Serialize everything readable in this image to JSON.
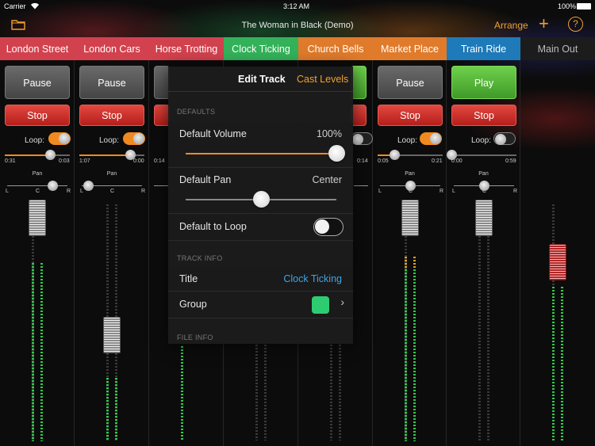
{
  "status": {
    "carrier": "Carrier",
    "time": "3:12 AM",
    "battery": "100%"
  },
  "topbar": {
    "title": "The Woman in Black (Demo)",
    "arrange": "Arrange",
    "add_glyph": "+",
    "help_glyph": "?",
    "folder_icon": "folder-icon"
  },
  "colors": {
    "accent": "#f0a030",
    "link": "#3fa4e8",
    "group": "#2ecc71"
  },
  "tabs": [
    {
      "label": "London Street",
      "color": "#d2424e"
    },
    {
      "label": "London Cars",
      "color": "#d2424e"
    },
    {
      "label": "Horse Trotting",
      "color": "#d2424e"
    },
    {
      "label": "Clock Ticking",
      "color": "#34b25a"
    },
    {
      "label": "Church Bells",
      "color": "#e07b2c"
    },
    {
      "label": "Market Place",
      "color": "#e07b2c"
    },
    {
      "label": "Train Ride",
      "color": "#1e7ab8"
    },
    {
      "label": "Main Out",
      "color": "#1c1c1c"
    }
  ],
  "strips": [
    {
      "name": "London Street",
      "play_label": "Pause",
      "stop_label": "Stop",
      "loop_label": "Loop:",
      "loop_on": true,
      "progress": 0.7,
      "elapsed": "0:31",
      "remaining": "0:03",
      "pan_label": "Pan",
      "pan_l": "L",
      "pan_c": "C",
      "pan_r": "R",
      "pan": 0.75,
      "volume": 0.95
    },
    {
      "name": "London Cars",
      "play_label": "Pause",
      "stop_label": "Stop",
      "loop_label": "Loop:",
      "loop_on": true,
      "progress": 0.78,
      "elapsed": "1:07",
      "remaining": "0:00",
      "pan_label": "Pan",
      "pan_l": "L",
      "pan_c": "C",
      "pan_r": "R",
      "pan": 0.1,
      "volume": 0.5
    },
    {
      "name": "Horse Trotting",
      "play_label": "Pause",
      "stop_label": "Stop",
      "elapsed": "0:14"
    },
    {
      "name": "Clock Ticking",
      "remaining": "0:14"
    },
    {
      "name": "Market Place",
      "play_label": "Pause",
      "stop_label": "Stop",
      "loop_label": "Loop:",
      "loop_on": true,
      "progress": 0.25,
      "elapsed": "0:05",
      "remaining": "0:21",
      "pan_label": "Pan",
      "pan_l": "L",
      "pan_c": "C",
      "pan_r": "R",
      "pan": 0.5,
      "volume": 0.95
    },
    {
      "name": "Train Ride",
      "play_label": "Play",
      "stop_label": "Stop",
      "loop_label": "Loop:",
      "loop_on": false,
      "progress": 0.0,
      "elapsed": "0:00",
      "remaining": "0:59",
      "pan_label": "Pan",
      "pan_l": "L",
      "pan_c": "C",
      "pan_r": "R",
      "pan": 0.5,
      "volume": 0.95
    },
    {
      "name": "Main Out",
      "volume": 0.72
    }
  ],
  "edit_track": {
    "tab_edit": "Edit Track",
    "tab_cast": "Cast Levels",
    "defaults_header": "DEFAULTS",
    "volume_label": "Default Volume",
    "volume_value": "100%",
    "volume_level": 1.0,
    "pan_label": "Default Pan",
    "pan_value": "Center",
    "pan_level": 0.5,
    "loop_label": "Default to Loop",
    "loop_on": false,
    "track_info_header": "TRACK INFO",
    "title_label": "Title",
    "title_value": "Clock Ticking",
    "group_label": "Group",
    "file_info_header": "FILE INFO"
  }
}
